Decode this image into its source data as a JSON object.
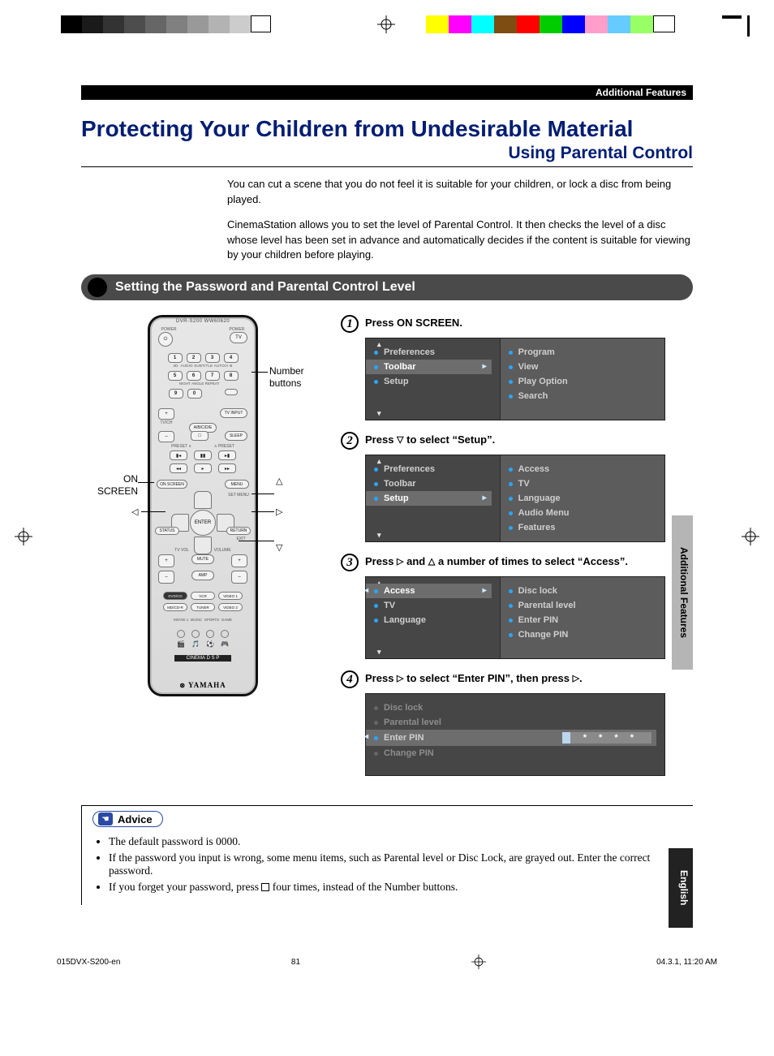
{
  "header_bar": "Additional Features",
  "title": "Protecting Your Children from Undesirable Material",
  "subtitle": "Using Parental Control",
  "intro": {
    "p1": "You can cut a scene that you do not feel it is suitable for your children, or lock a disc from being played.",
    "p2": "CinemaStation allows you to set the level of Parental Control. It then checks the level of a disc whose level has been set in advance and automatically decides if the content is suitable for viewing by your children before playing."
  },
  "section_heading": "Setting the Password and Parental Control Level",
  "remote": {
    "model": "DVR-S200 WW60620",
    "power_label": "POWER",
    "tvch": "TV/CH",
    "tv": "TV",
    "numbers": [
      "1",
      "2",
      "3",
      "4",
      "5",
      "6",
      "7",
      "8",
      "9",
      "0"
    ],
    "row2_labels": [
      "3D",
      "AUDIO",
      "SUBTITLE",
      "AUTO/\nA·B",
      "NIGHT",
      "ANGLE",
      "REPEAT"
    ],
    "plus": "+",
    "minus": "–",
    "tv_input": "TV INPUT",
    "abcd": "A/B/C/D/E",
    "sleep": "SLEEP",
    "preset": "PRESET",
    "onscreen": "ON SCREEN",
    "menu": "MENU",
    "status": "STATUS",
    "return": "RETURN",
    "setmenu": "SET MENU",
    "exit": "EXIT",
    "enter": "ENTER",
    "tvvol": "TV VOL",
    "vol": "VOLUME",
    "mute": "MUTE",
    "amp": "AMP",
    "sources": [
      "DVD/CD",
      "VCR",
      "VIDEO 1",
      "MD/CD-R",
      "TUNER",
      "VIDEO 2"
    ],
    "dsp": [
      "MOVIE 1",
      "MUSIC",
      "SPORTS",
      "GAME"
    ],
    "cinema": "CINEMA",
    "brand": "YAMAHA"
  },
  "callouts": {
    "number_buttons": "Number buttons",
    "onscreen_lbl_l1": "ON",
    "onscreen_lbl_l2": "SCREEN"
  },
  "steps": {
    "s1": {
      "num": "1",
      "text": "Press ON SCREEN.",
      "osd_left": [
        "Preferences",
        "Toolbar",
        "Setup"
      ],
      "osd_left_sel": 1,
      "osd_right": [
        "Program",
        "View",
        "Play Option",
        "Search"
      ]
    },
    "s2": {
      "num": "2",
      "text_pre": "Press ",
      "text_post": " to select “Setup”.",
      "osd_left": [
        "Preferences",
        "Toolbar",
        "Setup"
      ],
      "osd_left_sel": 2,
      "osd_right": [
        "Access",
        "TV",
        "Language",
        "Audio Menu",
        "Features"
      ]
    },
    "s3": {
      "num": "3",
      "text_pre": "Press ",
      "text_mid": " and ",
      "text_post": " a number of times to select “Access”.",
      "osd_left": [
        "Access",
        "TV",
        "Language"
      ],
      "osd_left_sel": 0,
      "osd_right": [
        "Disc lock",
        "Parental level",
        "Enter PIN",
        "Change PIN"
      ]
    },
    "s4": {
      "num": "4",
      "text_pre": "Press ",
      "text_mid": " to select “Enter PIN”, then press ",
      "text_post": ".",
      "osd_left": [
        "Disc lock",
        "Parental level",
        "Enter PIN",
        "Change PIN"
      ],
      "pin_mask": "* * * *"
    }
  },
  "side_tab_af": "Additional Features",
  "side_tab_en": "English",
  "advice": {
    "label": "Advice",
    "items": [
      "The default password is 0000.",
      "If the password you input is wrong, some menu items, such as Parental level or Disc Lock, are grayed out. Enter the correct password.",
      "If you forget your password, press  four times, instead of the Number buttons."
    ],
    "item3_pre": "If you forget your password, press ",
    "item3_post": " four times, instead of the Number buttons."
  },
  "page_number": "81",
  "footer": {
    "left": "015DVX-S200-en",
    "center": "81",
    "right": "04.3.1, 11:20 AM"
  }
}
